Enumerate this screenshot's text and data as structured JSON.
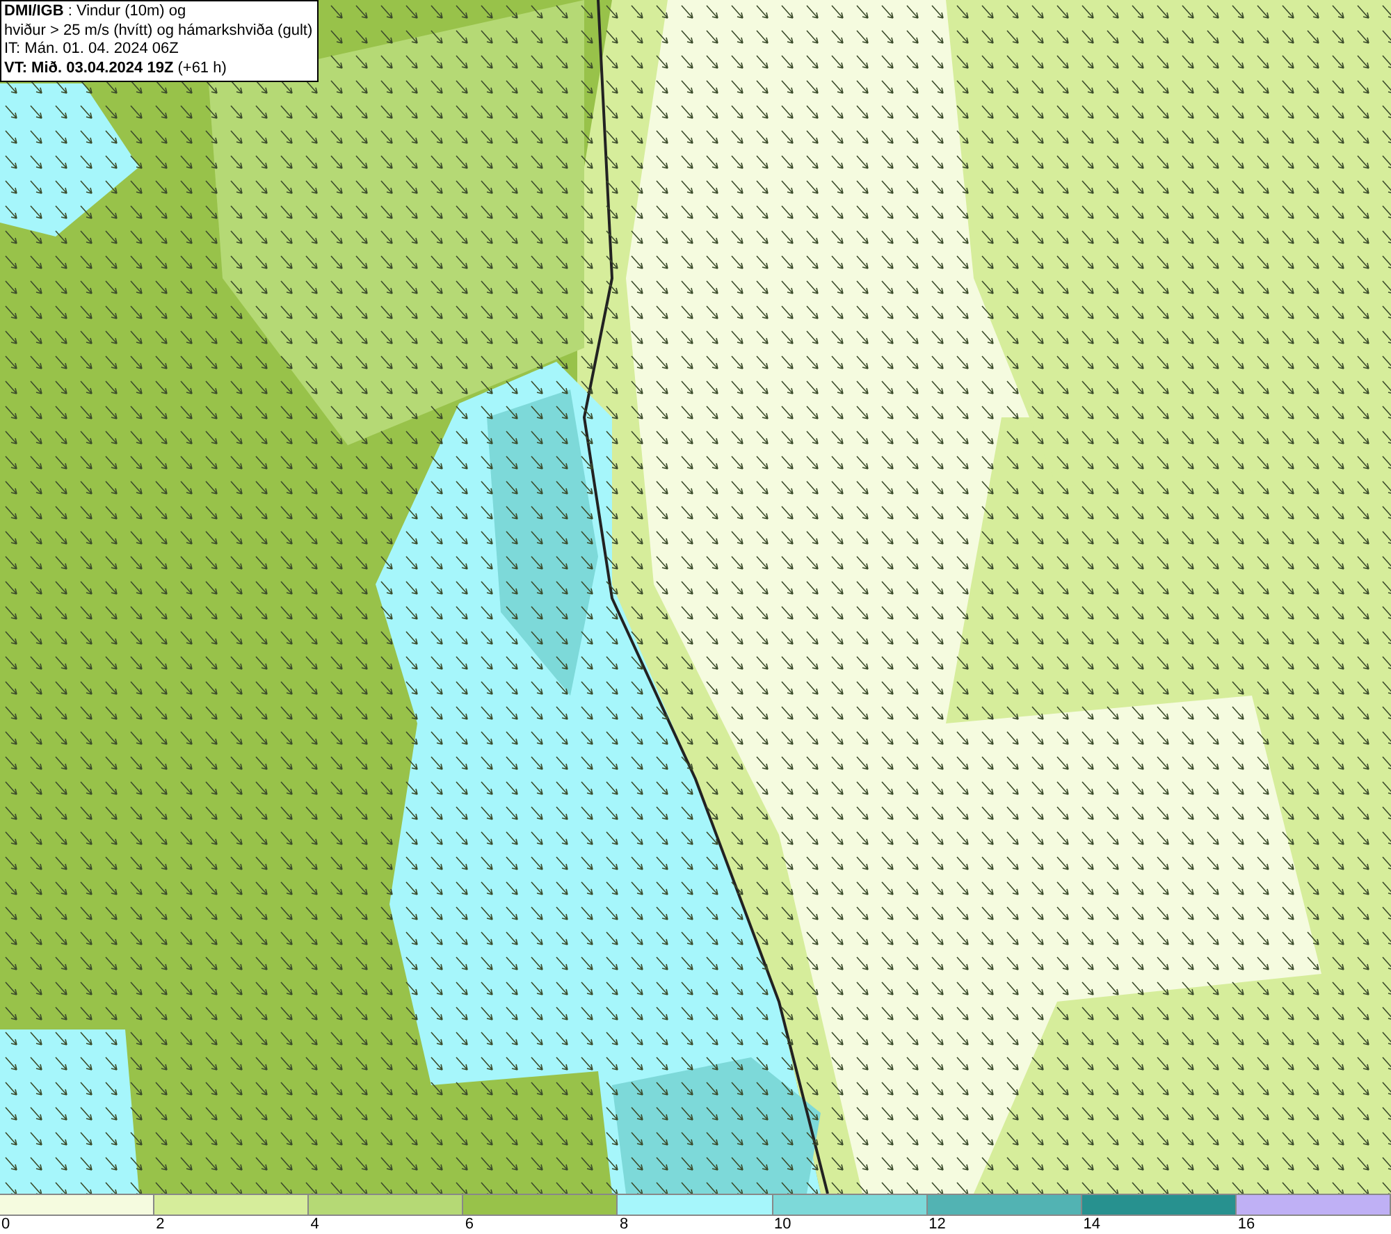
{
  "header": {
    "lines": [
      "**DMI/IGB** : Vindur (10m) og",
      "hviður > 25 m/s (hvítt) og hámarkshviða (gult)",
      "IT: Mán. 01. 04. 2024 06Z",
      "**VT: Mið. 03.04.2024 19Z** (+61 h)"
    ]
  },
  "legend": {
    "bins": [
      {
        "label": "0",
        "color": "#f5fbdf"
      },
      {
        "label": "2",
        "color": "#d6ed9b"
      },
      {
        "label": "4",
        "color": "#b5d975"
      },
      {
        "label": "6",
        "color": "#98c24a"
      },
      {
        "label": "8",
        "color": "#a6f6fb"
      },
      {
        "label": "10",
        "color": "#7dd9d9"
      },
      {
        "label": "12",
        "color": "#52b3b3"
      },
      {
        "label": "14",
        "color": "#27918f"
      },
      {
        "label": "16",
        "color": "#bfb0f5"
      }
    ]
  }
}
